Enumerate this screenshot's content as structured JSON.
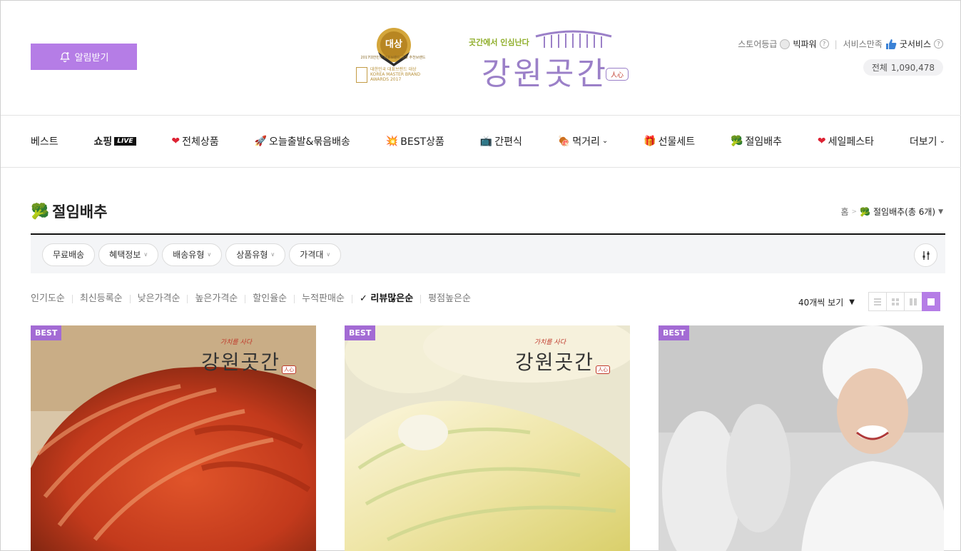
{
  "header": {
    "notify_label": "알림받기",
    "award": {
      "title": "대상",
      "line1": "2017대한민국 대표브랜드 공모 추천브랜드",
      "line2": "대한민국 대표브랜드 대상",
      "line3": "KOREA MASTER BRAND",
      "line4": "AWARDS 2017",
      "box_label": "MASTER BRAND"
    },
    "brand": {
      "tagline": "곳간에서 인심난다",
      "name": "강원곳간",
      "stamp": "人心"
    },
    "store_grade_label": "스토어등급",
    "store_grade_value": "빅파워",
    "service_label": "서비스만족",
    "service_value": "굿서비스",
    "total_label": "전체",
    "total_value": "1,090,478"
  },
  "nav": {
    "items": [
      {
        "label": "베스트",
        "icon": ""
      },
      {
        "label": "쇼핑",
        "badge": "LIVE"
      },
      {
        "label": "전체상품",
        "icon": "❤"
      },
      {
        "label": "오늘출발&묶음배송",
        "icon": "🚀"
      },
      {
        "label": "BEST상품",
        "icon": "💥"
      },
      {
        "label": "간편식",
        "icon": "📺"
      },
      {
        "label": "먹거리",
        "icon": "🍖"
      },
      {
        "label": "선물세트",
        "icon": "🎁"
      },
      {
        "label": "절임배추",
        "icon": "🥦"
      },
      {
        "label": "세일페스타",
        "icon": "❤"
      }
    ],
    "more_label": "더보기"
  },
  "category": {
    "icon": "🥦",
    "title": "절임배추",
    "breadcrumb_home": "홈",
    "breadcrumb_current": "절임배추(총 6개)"
  },
  "filters": [
    {
      "label": "무료배송",
      "dropdown": false
    },
    {
      "label": "혜택정보",
      "dropdown": true
    },
    {
      "label": "배송유형",
      "dropdown": true
    },
    {
      "label": "상품유형",
      "dropdown": true
    },
    {
      "label": "가격대",
      "dropdown": true
    }
  ],
  "sort": {
    "options": [
      "인기도순",
      "최신등록순",
      "낮은가격순",
      "높은가격순",
      "할인율순",
      "누적판매순",
      "리뷰많은순",
      "평점높은순"
    ],
    "active": "리뷰많은순",
    "per_page": "40개씩 보기"
  },
  "products": [
    {
      "badge": "BEST",
      "wm_tag": "가치를 사다",
      "wm_name": "강원곳간",
      "wm_stamp": "人心"
    },
    {
      "badge": "BEST",
      "wm_tag": "가치를 사다",
      "wm_name": "강원곳간",
      "wm_stamp": "人心"
    },
    {
      "badge": "BEST"
    }
  ],
  "colors": {
    "accent": "#b57de6",
    "best_badge": "#a36bd4",
    "brand_purple": "#9b80c8"
  }
}
